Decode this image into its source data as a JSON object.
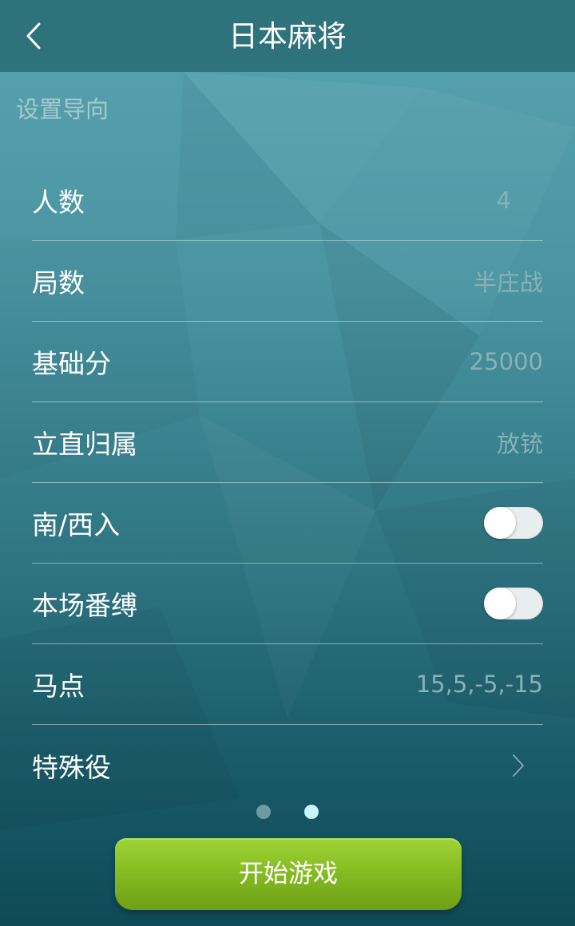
{
  "header": {
    "back_icon": "chevron-left-icon",
    "title": "日本麻将"
  },
  "section": {
    "label": "设置导向"
  },
  "settings": [
    {
      "label": "人数",
      "value": "4"
    },
    {
      "label": "局数",
      "value": "半庄战"
    },
    {
      "label": "基础分",
      "value": "25000"
    },
    {
      "label": "立直归属",
      "value": "放铳"
    },
    {
      "label": "南/西入",
      "toggle": false
    },
    {
      "label": "本场番缚",
      "toggle": false
    },
    {
      "label": "马点",
      "value": "15,5,-5,-15"
    },
    {
      "label": "特殊役",
      "icon": "chevron-right-icon"
    }
  ],
  "pager": {
    "pages": 2,
    "active": 2
  },
  "start_button": {
    "label": "开始游戏"
  },
  "colors": {
    "header_bg": "#2e727c",
    "background_top": "#58a3b0",
    "background_bottom": "#0e4a57",
    "button_green": "#86bd22",
    "value_text": "#88b2b7"
  }
}
